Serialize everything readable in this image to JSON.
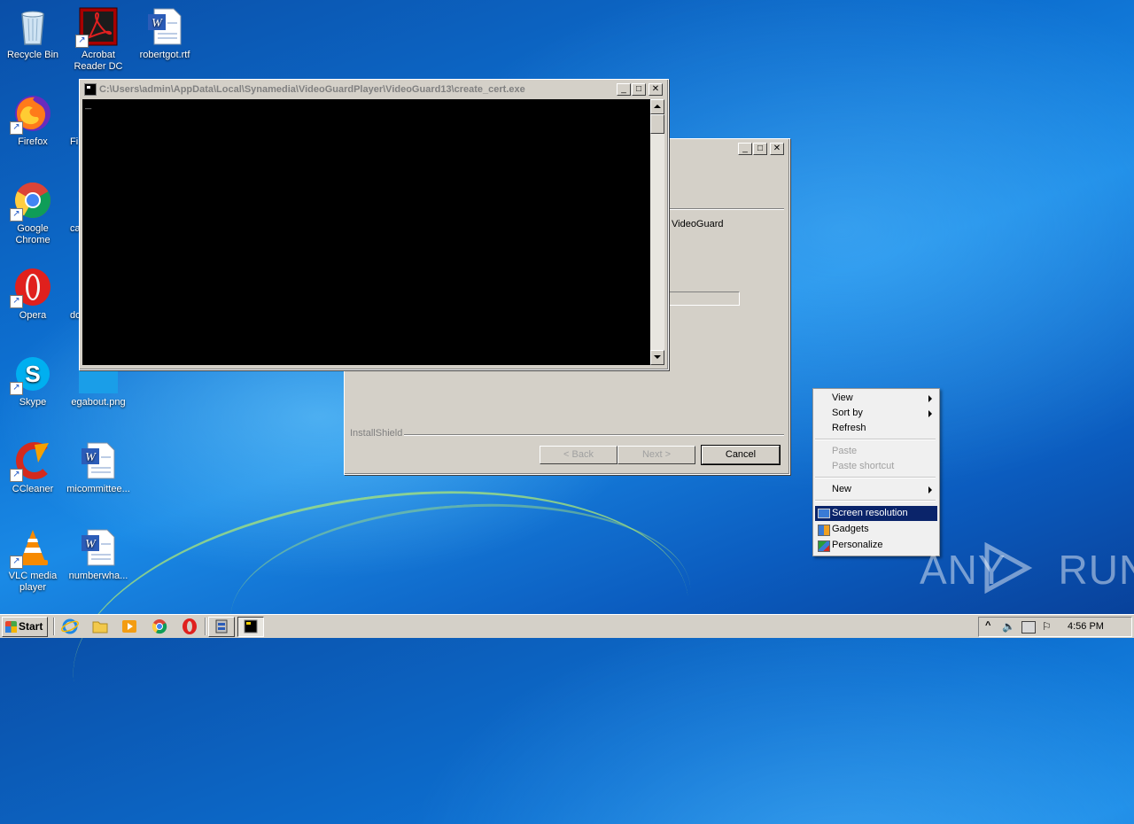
{
  "desktop": {
    "icons": [
      {
        "label": "Recycle Bin"
      },
      {
        "label": "Acrobat Reader DC"
      },
      {
        "label": "robertgot.rtf"
      },
      {
        "label": "Firefox"
      },
      {
        "label": "Fi"
      },
      {
        "label": "Google Chrome"
      },
      {
        "label": "ca"
      },
      {
        "label": "Opera"
      },
      {
        "label": "do"
      },
      {
        "label": "Skype"
      },
      {
        "label": "egabout.png"
      },
      {
        "label": "CCleaner"
      },
      {
        "label": "micommittee..."
      },
      {
        "label": "VLC media player"
      },
      {
        "label": "numberwha..."
      }
    ]
  },
  "console_window": {
    "title": "C:\\Users\\admin\\AppData\\Local\\Synamedia\\VideoGuardPlayer\\VideoGuard13\\create_cert.exe",
    "cursor": "_"
  },
  "installer_window": {
    "product_text": "VideoGuard",
    "brand": "InstallShield",
    "back_button": "< Back",
    "next_button": "Next >",
    "cancel_button": "Cancel"
  },
  "context_menu": {
    "items": [
      {
        "label": "View"
      },
      {
        "label": "Sort by"
      },
      {
        "label": "Refresh"
      },
      {
        "label": "Paste"
      },
      {
        "label": "Paste shortcut"
      },
      {
        "label": "New"
      },
      {
        "label": "Screen resolution"
      },
      {
        "label": "Gadgets"
      },
      {
        "label": "Personalize"
      }
    ]
  },
  "taskbar": {
    "start_label": "Start",
    "clock": "4:56 PM",
    "tray_chevron": "^"
  },
  "watermark": {
    "text": "ANY RUN"
  },
  "colors": {
    "console_bg": "#000000",
    "menu_highlight": "#0a246a",
    "window_face": "#d4d0c8"
  }
}
